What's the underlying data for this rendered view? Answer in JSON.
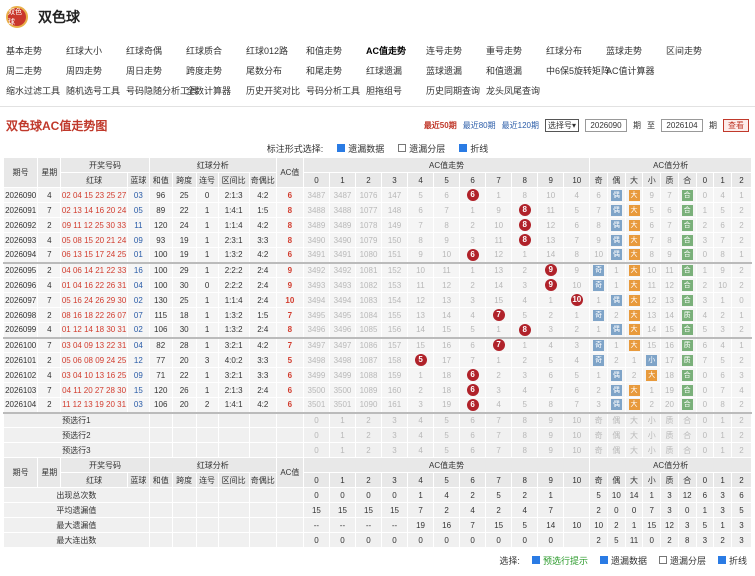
{
  "app": {
    "logo_text": "双色球",
    "title": "双色球"
  },
  "nav": [
    [
      "基本走势",
      "红球大小",
      "红球奇偶",
      "红球质合",
      "红球012路",
      "和值走势",
      "AC值走势",
      "连号走势",
      "重号走势",
      "红球分布",
      "蓝球走势",
      "区间走势"
    ],
    [
      "周二走势",
      "周四走势",
      "周日走势",
      "跨度走势",
      "尾数分布",
      "和尾走势",
      "红球遗漏",
      "蓝球遗漏",
      "和值遗漏",
      "中6保5旋转矩阵",
      "AC值计算器"
    ],
    [
      "缩水过滤工具",
      "随机选号工具",
      "号码隐随分析工具",
      "全数计算器",
      "历史开奖对比",
      "号码分析工具",
      "胆拖组号",
      "历史同期查询",
      "龙头凤尾查询"
    ]
  ],
  "toolbar": {
    "title": "双色球AC值走势图",
    "links": [
      "最近50期",
      "最近80期",
      "最近120期"
    ],
    "select": "选择号",
    "from": "2026090",
    "to": "2026104",
    "qi": "期",
    "zhi": "至",
    "query": "查看"
  },
  "options": {
    "label": "标注形式选择:",
    "items": [
      "遗漏数据",
      "遗漏分层",
      "折线"
    ]
  },
  "headers": {
    "issue": "期号",
    "week": "星期",
    "draw": "开奖号码",
    "red": "红球",
    "blue": "蓝球",
    "analysis": "红球分析",
    "sum": "和值",
    "span": "跨度",
    "consec": "连号",
    "zone": "区间比",
    "oddeven": "奇偶比",
    "ac": "AC值",
    "trend": "AC值走势",
    "acanalysis": "AC值分析",
    "trendcols": [
      "0",
      "1",
      "2",
      "3",
      "4",
      "5",
      "6",
      "7",
      "8",
      "9",
      "10"
    ],
    "acan": [
      "奇",
      "偶",
      "大",
      "小",
      "质",
      "合",
      "0",
      "1",
      "2"
    ]
  },
  "rows": [
    {
      "i": "2026090",
      "w": "4",
      "r": "02 04 15 23 25 27",
      "b": "03",
      "s": "96",
      "sp": "25",
      "c": "0",
      "z": "2:1:3",
      "o": "4:2",
      "ac": "6",
      "t": [
        "3487",
        "3487",
        "1076",
        "147",
        "5",
        "6",
        "●6",
        "1",
        "8",
        "10",
        "4"
      ],
      "a": [
        "6",
        "偶",
        "大",
        "9",
        "7",
        "合",
        "0",
        "4",
        "1"
      ]
    },
    {
      "i": "2026091",
      "w": "7",
      "r": "02 13 14 16 20 24",
      "b": "05",
      "s": "89",
      "sp": "22",
      "c": "1",
      "z": "1:4:1",
      "o": "1:5",
      "ac": "8",
      "t": [
        "3488",
        "3488",
        "1077",
        "148",
        "6",
        "7",
        "1",
        "9",
        "●8",
        "11",
        "5"
      ],
      "a": [
        "7",
        "偶",
        "大",
        "5",
        "6",
        "合",
        "1",
        "5",
        "2"
      ]
    },
    {
      "i": "2026092",
      "w": "2",
      "r": "09 11 12 25 30 33",
      "b": "11",
      "s": "120",
      "sp": "24",
      "c": "1",
      "z": "1:1:4",
      "o": "4:2",
      "ac": "8",
      "t": [
        "3489",
        "3489",
        "1078",
        "149",
        "7",
        "8",
        "2",
        "10",
        "●8",
        "12",
        "6"
      ],
      "a": [
        "8",
        "偶",
        "大",
        "6",
        "7",
        "合",
        "2",
        "6",
        "2"
      ]
    },
    {
      "i": "2026093",
      "w": "4",
      "r": "05 08 15 20 21 24",
      "b": "09",
      "s": "93",
      "sp": "19",
      "c": "1",
      "z": "2:3:1",
      "o": "3:3",
      "ac": "8",
      "t": [
        "3490",
        "3490",
        "1079",
        "150",
        "8",
        "9",
        "3",
        "11",
        "●8",
        "13",
        "7"
      ],
      "a": [
        "9",
        "偶",
        "大",
        "7",
        "8",
        "合",
        "3",
        "7",
        "2"
      ]
    },
    {
      "i": "2026094",
      "w": "7",
      "r": "06 13 15 17 24 25",
      "b": "01",
      "s": "100",
      "sp": "19",
      "c": "1",
      "z": "1:3:2",
      "o": "4:2",
      "ac": "6",
      "t": [
        "3491",
        "3491",
        "1080",
        "151",
        "9",
        "10",
        "●6",
        "12",
        "1",
        "14",
        "8"
      ],
      "a": [
        "10",
        "偶",
        "大",
        "8",
        "9",
        "合",
        "0",
        "8",
        "1"
      ]
    },
    {
      "i": "2026095",
      "w": "2",
      "r": "04 06 14 21 22 33",
      "b": "16",
      "s": "100",
      "sp": "29",
      "c": "1",
      "z": "2:2:2",
      "o": "2:4",
      "ac": "9",
      "t": [
        "3492",
        "3492",
        "1081",
        "152",
        "10",
        "11",
        "1",
        "13",
        "2",
        "●9",
        "9"
      ],
      "a": [
        "奇",
        "1",
        "大",
        "10",
        "11",
        "合",
        "1",
        "9",
        "2"
      ]
    },
    {
      "i": "2026096",
      "w": "4",
      "r": "01 04 16 22 26 31",
      "b": "04",
      "s": "100",
      "sp": "30",
      "c": "0",
      "z": "2:2:2",
      "o": "2:4",
      "ac": "9",
      "t": [
        "3493",
        "3493",
        "1082",
        "153",
        "11",
        "12",
        "2",
        "14",
        "3",
        "●9",
        "10"
      ],
      "a": [
        "奇",
        "1",
        "大",
        "11",
        "12",
        "合",
        "2",
        "10",
        "2"
      ]
    },
    {
      "i": "2026097",
      "w": "7",
      "r": "05 16 24 26 29 30",
      "b": "02",
      "s": "130",
      "sp": "25",
      "c": "1",
      "z": "1:1:4",
      "o": "2:4",
      "ac": "10",
      "t": [
        "3494",
        "3494",
        "1083",
        "154",
        "12",
        "13",
        "3",
        "15",
        "4",
        "1",
        "●10"
      ],
      "a": [
        "1",
        "偶",
        "大",
        "12",
        "13",
        "合",
        "3",
        "1",
        "0"
      ]
    },
    {
      "i": "2026098",
      "w": "2",
      "r": "08 16 18 22 26 07",
      "b": "07",
      "s": "115",
      "sp": "18",
      "c": "1",
      "z": "1:3:2",
      "o": "1:5",
      "ac": "7",
      "t": [
        "3495",
        "3495",
        "1084",
        "155",
        "13",
        "14",
        "4",
        "●7",
        "5",
        "2",
        "1"
      ],
      "a": [
        "奇",
        "2",
        "大",
        "13",
        "14",
        "质",
        "4",
        "2",
        "1"
      ]
    },
    {
      "i": "2026099",
      "w": "4",
      "r": "01 12 14 18 30 31",
      "b": "02",
      "s": "106",
      "sp": "30",
      "c": "1",
      "z": "1:3:2",
      "o": "2:4",
      "ac": "8",
      "t": [
        "3496",
        "3496",
        "1085",
        "156",
        "14",
        "15",
        "5",
        "1",
        "●8",
        "3",
        "2"
      ],
      "a": [
        "1",
        "偶",
        "大",
        "14",
        "15",
        "合",
        "5",
        "3",
        "2"
      ]
    },
    {
      "i": "2026100",
      "w": "7",
      "r": "03 04 09 13 22 31",
      "b": "04",
      "s": "82",
      "sp": "28",
      "c": "1",
      "z": "3:2:1",
      "o": "4:2",
      "ac": "7",
      "t": [
        "3497",
        "3497",
        "1086",
        "157",
        "15",
        "16",
        "6",
        "●7",
        "1",
        "4",
        "3"
      ],
      "a": [
        "奇",
        "1",
        "大",
        "15",
        "16",
        "质",
        "6",
        "4",
        "1"
      ]
    },
    {
      "i": "2026101",
      "w": "2",
      "r": "05 06 08 09 24 25",
      "b": "12",
      "s": "77",
      "sp": "20",
      "c": "3",
      "z": "4:0:2",
      "o": "3:3",
      "ac": "5",
      "t": [
        "3498",
        "3498",
        "1087",
        "158",
        "●5",
        "17",
        "7",
        "1",
        "2",
        "5",
        "4"
      ],
      "a": [
        "奇",
        "2",
        "1",
        "小",
        "17",
        "质",
        "7",
        "5",
        "2"
      ]
    },
    {
      "i": "2026102",
      "w": "4",
      "r": "03 04 10 13 16 25",
      "b": "09",
      "s": "71",
      "sp": "22",
      "c": "1",
      "z": "3:2:1",
      "o": "3:3",
      "ac": "6",
      "t": [
        "3499",
        "3499",
        "1088",
        "159",
        "1",
        "18",
        "●6",
        "2",
        "3",
        "6",
        "5"
      ],
      "a": [
        "1",
        "偶",
        "2",
        "大",
        "18",
        "合",
        "0",
        "6",
        "3"
      ]
    },
    {
      "i": "2026103",
      "w": "7",
      "r": "04 11 20 27 28 30",
      "b": "15",
      "s": "120",
      "sp": "26",
      "c": "1",
      "z": "2:1:3",
      "o": "2:4",
      "ac": "6",
      "t": [
        "3500",
        "3500",
        "1089",
        "160",
        "2",
        "18",
        "●6",
        "3",
        "4",
        "7",
        "6"
      ],
      "a": [
        "2",
        "偶",
        "大",
        "1",
        "19",
        "合",
        "0",
        "7",
        "4"
      ]
    },
    {
      "i": "2026104",
      "w": "2",
      "r": "11 12 13 19 20 31",
      "b": "03",
      "s": "106",
      "sp": "20",
      "c": "2",
      "z": "1:4:1",
      "o": "4:2",
      "ac": "6",
      "t": [
        "3501",
        "3501",
        "1090",
        "161",
        "3",
        "19",
        "●6",
        "4",
        "5",
        "8",
        "7"
      ],
      "a": [
        "3",
        "偶",
        "大",
        "2",
        "20",
        "合",
        "0",
        "8",
        "2"
      ]
    }
  ],
  "predict": [
    "预选行1",
    "预选行2",
    "预选行3"
  ],
  "predict_vals": [
    "0",
    "1",
    "2",
    "3",
    "4",
    "5",
    "6",
    "7",
    "8",
    "9",
    "10"
  ],
  "predict_an": [
    "奇",
    "偶",
    "大",
    "小",
    "质",
    "合",
    "0",
    "1",
    "2"
  ],
  "stats": [
    {
      "label": "出现总次数",
      "v": [
        "0",
        "0",
        "0",
        "0",
        "1",
        "4",
        "2",
        "5",
        "2",
        "1"
      ],
      "a": [
        "5",
        "10",
        "14",
        "1",
        "3",
        "12",
        "6",
        "3",
        "6"
      ]
    },
    {
      "label": "平均遗漏值",
      "v": [
        "15",
        "15",
        "15",
        "15",
        "7",
        "2",
        "4",
        "2",
        "4",
        "7"
      ],
      "a": [
        "2",
        "0",
        "0",
        "7",
        "3",
        "0",
        "1",
        "3",
        "5"
      ]
    },
    {
      "label": "最大遗漏值",
      "v": [
        "--",
        "--",
        "--",
        "--",
        "19",
        "16",
        "7",
        "15",
        "5",
        "14",
        "10"
      ],
      "a": [
        "10",
        "2",
        "1",
        "15",
        "12",
        "3",
        "5",
        "1",
        "3"
      ]
    },
    {
      "label": "最大连出数",
      "v": [
        "0",
        "0",
        "0",
        "0",
        "0",
        "0",
        "0",
        "0",
        "0",
        "0"
      ],
      "a": [
        "2",
        "5",
        "11",
        "0",
        "2",
        "8",
        "3",
        "2",
        "3"
      ]
    }
  ],
  "footer": {
    "label": "选择:",
    "items": [
      "预选行提示",
      "遗漏数据",
      "遗漏分层",
      "折线"
    ]
  }
}
